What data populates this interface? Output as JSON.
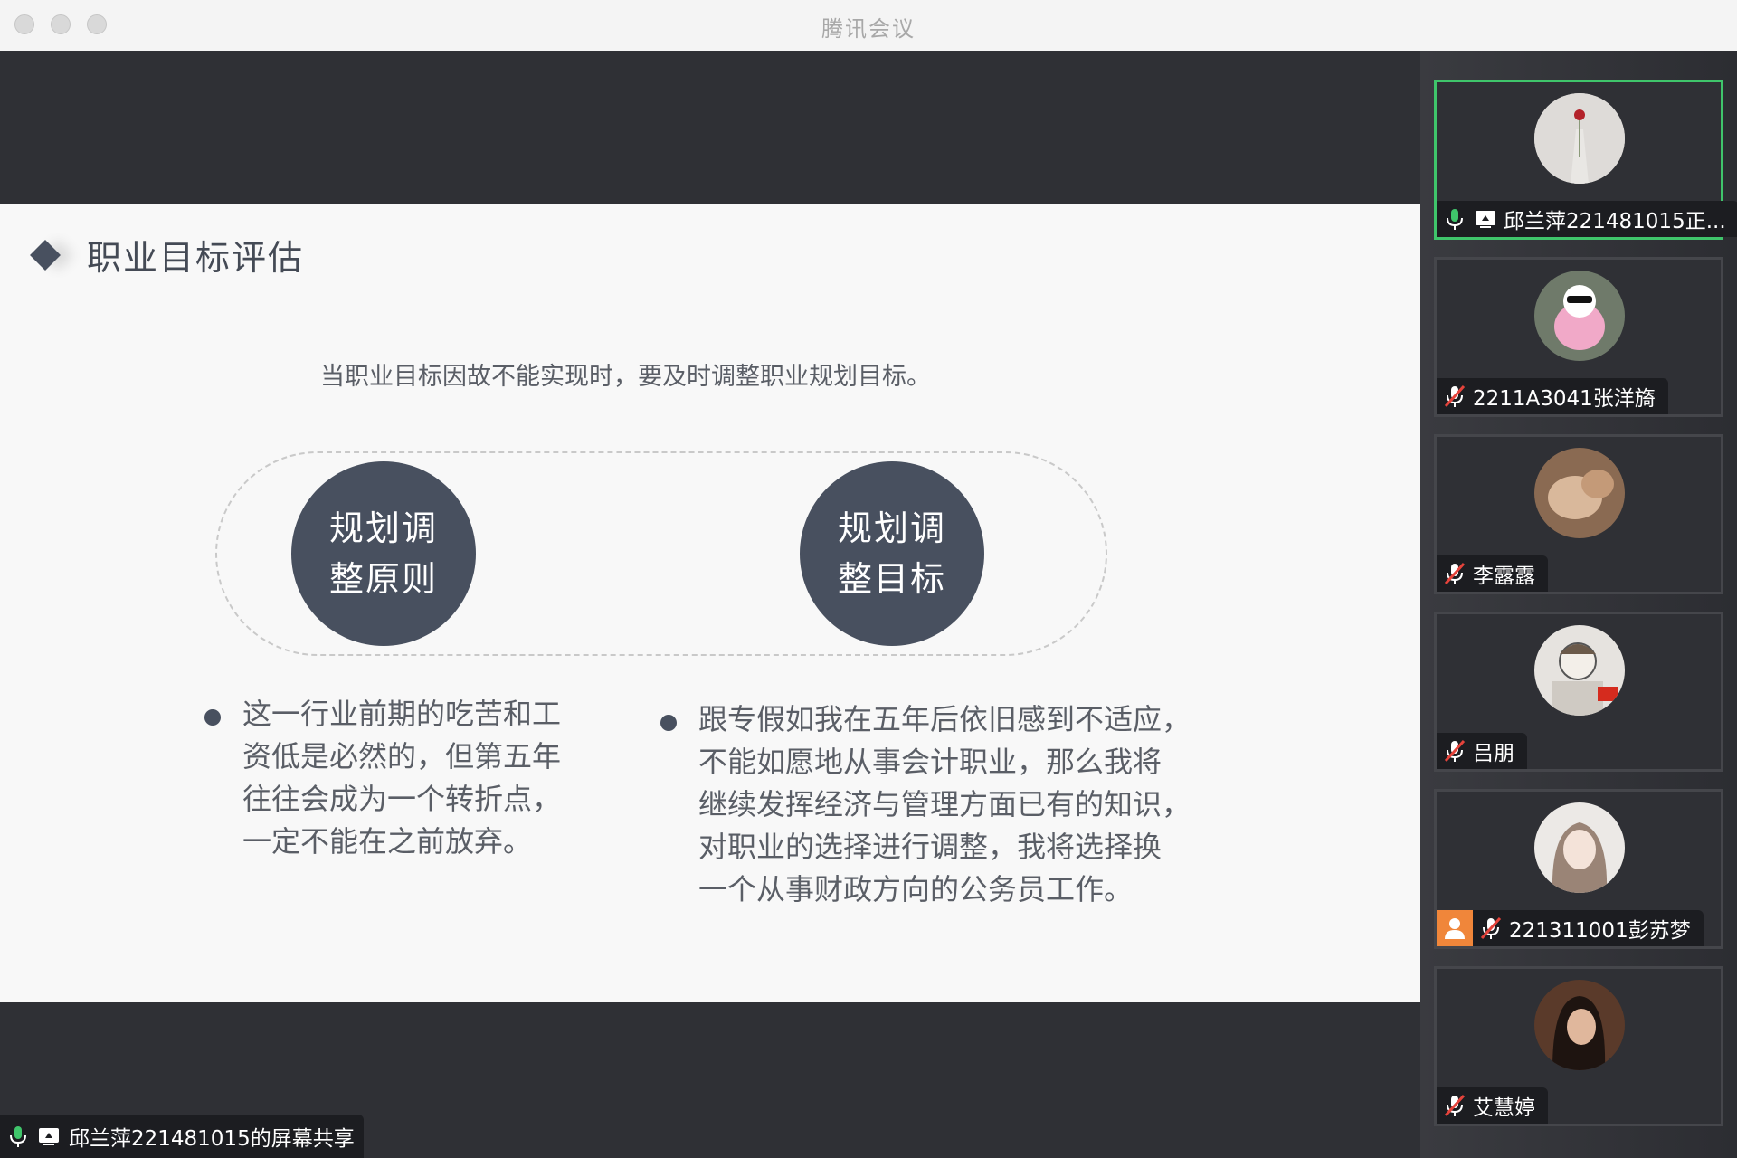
{
  "window": {
    "title": "腾讯会议"
  },
  "slide": {
    "title": "职业目标评估",
    "subtitle": "当职业目标因故不能实现时，要及时调整职业规划目标。",
    "circles": [
      "规划调整原则",
      "规划调整目标"
    ],
    "bullets": [
      [
        "这一行业前期的吃苦和工",
        "资低是必然的，但第五年",
        "往往会成为一个转折点，",
        "一定不能在之前放弃。"
      ],
      [
        "跟专假如我在五年后依旧感到不适应，",
        "不能如愿地从事会计职业，那么我将",
        "继续发挥经济与管理方面已有的知识，",
        "对职业的选择进行调整，我将选择换",
        "一个从事财政方向的公务员工作。"
      ]
    ]
  },
  "share_label": "邱兰萍221481015的屏幕共享",
  "participants": [
    {
      "name": "邱兰萍221481015正...",
      "mic": "on",
      "sharing": true,
      "speaking": true,
      "host": false
    },
    {
      "name": "2211A3041张洋旖",
      "mic": "muted",
      "sharing": false,
      "speaking": false,
      "host": false
    },
    {
      "name": "李露露",
      "mic": "muted",
      "sharing": false,
      "speaking": false,
      "host": false
    },
    {
      "name": "吕朋",
      "mic": "muted",
      "sharing": false,
      "speaking": false,
      "host": false
    },
    {
      "name": "221311001彭苏梦",
      "mic": "muted",
      "sharing": false,
      "speaking": false,
      "host": true
    },
    {
      "name": "艾慧婷",
      "mic": "muted",
      "sharing": false,
      "speaking": false,
      "host": false
    }
  ],
  "colors": {
    "accent_green": "#3fc56b",
    "slide_dark": "#48505f",
    "host_orange": "#f0863a",
    "muted_red": "#e5433b"
  }
}
